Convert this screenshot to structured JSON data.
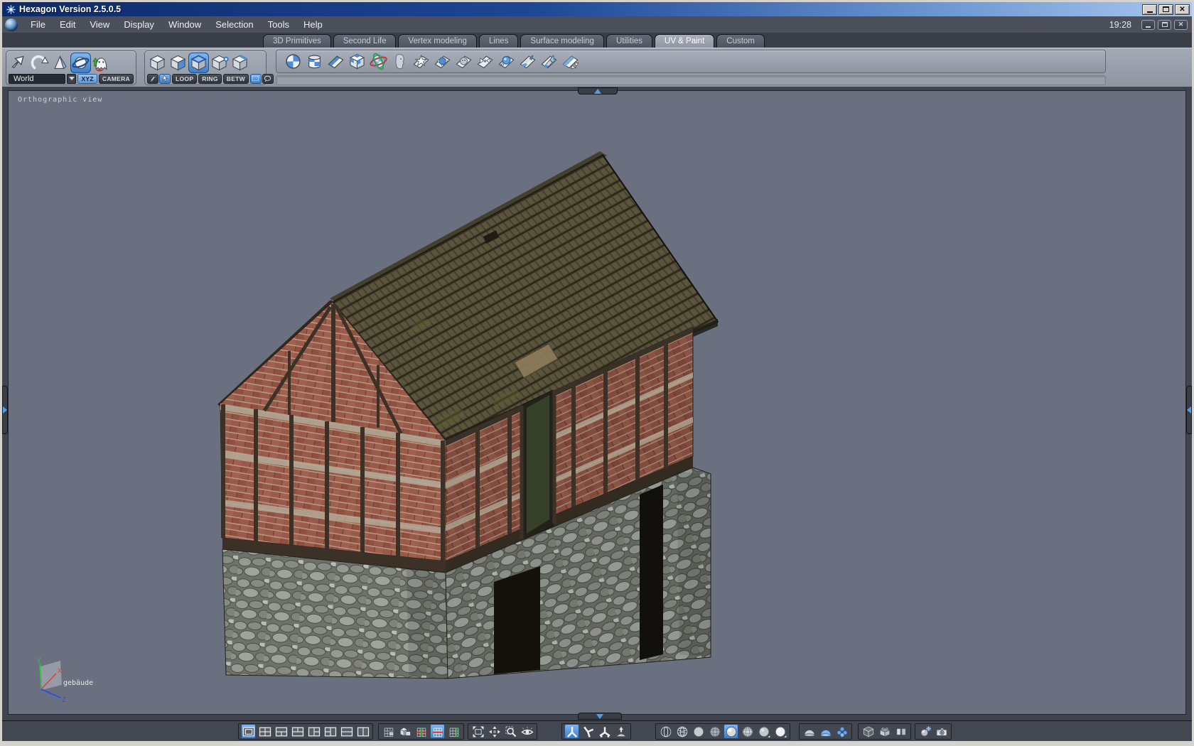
{
  "window": {
    "title": "Hexagon Version 2.5.0.5",
    "controls": [
      "minimize-icon",
      "maximize-icon",
      "close-icon"
    ]
  },
  "menubar": {
    "items": [
      "File",
      "Edit",
      "View",
      "Display",
      "Window",
      "Selection",
      "Tools",
      "Help"
    ],
    "clock": "19:28",
    "window_controls": [
      "minimize-icon",
      "maximize-icon",
      "close-icon"
    ]
  },
  "tabbar": {
    "tabs": [
      {
        "label": "3D Primitives",
        "active": false
      },
      {
        "label": "Second Life",
        "active": false
      },
      {
        "label": "Vertex modeling",
        "active": false
      },
      {
        "label": "Lines",
        "active": false
      },
      {
        "label": "Surface modeling",
        "active": false
      },
      {
        "label": "Utilities",
        "active": false
      },
      {
        "label": "UV & Paint",
        "active": true
      },
      {
        "label": "Custom",
        "active": false
      }
    ]
  },
  "toolbar": {
    "manipulator_group": {
      "icons": [
        {
          "name": "select-arrow-tool",
          "glyph": "arrow-nw",
          "active": false
        },
        {
          "name": "rotate-arrow-tool",
          "glyph": "arrow-curved",
          "active": false
        },
        {
          "name": "cone-manipulator-tool",
          "glyph": "cone",
          "active": false
        },
        {
          "name": "sphere-manipulator-tool",
          "glyph": "sphere-ring",
          "active": true
        },
        {
          "name": "ghost-visibility-tool",
          "glyph": "ghost",
          "active": false
        }
      ],
      "world_selector": {
        "value": "World"
      },
      "xyz_toggle": {
        "label": "XYZ",
        "active": true
      },
      "camera_toggle": {
        "label": "CAMERA",
        "active": false
      }
    },
    "selection_mode_group": {
      "icons": [
        {
          "name": "object-selection-mode",
          "glyph": "cube",
          "active": false
        },
        {
          "name": "face-selection-mode",
          "glyph": "cube-face",
          "active": false
        },
        {
          "name": "edge-selection-mode",
          "glyph": "cube-top",
          "active": true
        },
        {
          "name": "vertex-selection-mode",
          "glyph": "cube-vertex",
          "active": false
        },
        {
          "name": "border-selection-mode",
          "glyph": "cube-edge",
          "active": false
        }
      ],
      "small_tools": [
        {
          "name": "paint-select-tool",
          "glyph": "brush-sm",
          "active": false
        },
        {
          "name": "arrow-select-tool",
          "glyph": "arrow-sm",
          "active": true
        }
      ],
      "buttons": [
        {
          "label": "LOOP"
        },
        {
          "label": "RING"
        },
        {
          "label": "BETW"
        }
      ],
      "marquee_tools": [
        {
          "name": "rectangle-select-tool",
          "glyph": "marquee",
          "active": true
        },
        {
          "name": "lasso-select-tool",
          "glyph": "lasso",
          "active": false
        }
      ]
    },
    "uv_paint_tools": [
      {
        "name": "spherical-projection-tool",
        "glyph": "sphere-check"
      },
      {
        "name": "cylindrical-projection-tool",
        "glyph": "cyl-check"
      },
      {
        "name": "planar-projection-tool",
        "glyph": "plane-check"
      },
      {
        "name": "cubic-projection-tool",
        "glyph": "cube-check"
      },
      {
        "name": "uv-globe-unwrap-tool",
        "glyph": "globe"
      },
      {
        "name": "unfold-head-tool",
        "glyph": "head"
      },
      {
        "name": "star-stamp-tool",
        "glyph": "star-plane"
      },
      {
        "name": "inflate-surface-tool",
        "glyph": "pts-plane"
      },
      {
        "name": "smudge-surface-tool",
        "glyph": "face-plane"
      },
      {
        "name": "pinch-surface-tool",
        "glyph": "pinch-plane"
      },
      {
        "name": "bump-surface-tool",
        "glyph": "sphere-plane"
      },
      {
        "name": "paint-brush-tool",
        "glyph": "brush-plane"
      },
      {
        "name": "paint-tube-tool",
        "glyph": "brush2-plane"
      },
      {
        "name": "uv-transform-tool",
        "glyph": "plane-arrows"
      }
    ]
  },
  "viewport": {
    "label": "Orthographic view",
    "object_name": "gebäude",
    "axes": {
      "x": "X",
      "y": "Y",
      "z": "Z"
    },
    "background": "#6a7080",
    "collapse_handles": [
      "top",
      "bottom",
      "left",
      "right"
    ],
    "model_materials": {
      "roof_tiles": "#57503a",
      "brick": "#9a5a49",
      "timber": "#3c3127",
      "stone": "#8b9089",
      "mortar_band": "#b0a593"
    }
  },
  "bottombar": {
    "groups": [
      {
        "name": "viewport-layouts",
        "icons": [
          {
            "name": "layout-single-button",
            "glyph": "layout-1",
            "active": true
          },
          {
            "name": "layout-quad-button",
            "glyph": "layout-4"
          },
          {
            "name": "layout-top1-bottom2-button",
            "glyph": "layout-1t2b"
          },
          {
            "name": "layout-top2-bottom1-button",
            "glyph": "layout-2t1b"
          },
          {
            "name": "layout-left1-right2-button",
            "glyph": "layout-1l2r"
          },
          {
            "name": "layout-left2-right1-button",
            "glyph": "layout-2l1r"
          },
          {
            "name": "layout-2-rows-button",
            "glyph": "layout-2h"
          },
          {
            "name": "layout-2-columns-button",
            "glyph": "layout-2v"
          }
        ]
      },
      {
        "name": "grid-options",
        "icons": [
          {
            "name": "grid-paint-toggle",
            "glyph": "grid-lock"
          },
          {
            "name": "grid-lock-toggle",
            "glyph": "cube-lock"
          },
          {
            "name": "grid-xz-plane-toggle",
            "glyph": "grid-rg"
          },
          {
            "name": "grid-xy-plane-toggle",
            "glyph": "grid-blue",
            "active": true
          },
          {
            "name": "grid-yz-plane-toggle",
            "glyph": "grid-g"
          }
        ]
      },
      {
        "name": "view-controls",
        "icons": [
          {
            "name": "fit-view-button",
            "glyph": "expand"
          },
          {
            "name": "pan-view-button",
            "glyph": "pan"
          },
          {
            "name": "zoom-view-button",
            "glyph": "zoom"
          },
          {
            "name": "look-at-button",
            "glyph": "eye"
          }
        ]
      },
      {
        "name": "orientation-controls",
        "icons": [
          {
            "name": "axis-tripod-button",
            "glyph": "axis-y",
            "active": true
          },
          {
            "name": "axis-rotated-button",
            "glyph": "axis-k"
          },
          {
            "name": "axis-free-button",
            "glyph": "axis-bent"
          },
          {
            "name": "drop-to-view-button",
            "glyph": "dome-drop"
          }
        ]
      },
      {
        "name": "shading-modes",
        "icons": [
          {
            "name": "wireframe-mode-button",
            "glyph": "ball-wire"
          },
          {
            "name": "hidden-line-mode-button",
            "glyph": "ball-wire2"
          },
          {
            "name": "flat-shading-button",
            "glyph": "ball-flat"
          },
          {
            "name": "shaded-wireframe-button",
            "glyph": "ball-wiregrid"
          },
          {
            "name": "smooth-shading-button",
            "glyph": "ball-shaded",
            "active": true
          },
          {
            "name": "textured-shading-button",
            "glyph": "ball-grid"
          },
          {
            "name": "matte-shading-button",
            "glyph": "ball-matte",
            "flyout": true
          },
          {
            "name": "bright-shading-button",
            "glyph": "ball-bright",
            "flyout": true
          }
        ]
      },
      {
        "name": "backface-modes",
        "icons": [
          {
            "name": "dome-backface-button",
            "glyph": "dome"
          },
          {
            "name": "dome-shaded-button",
            "glyph": "dome-blue"
          },
          {
            "name": "multi-object-button",
            "glyph": "cluster"
          }
        ]
      },
      {
        "name": "display-extras",
        "icons": [
          {
            "name": "ghost-cube-toggle",
            "glyph": "cube-ghost"
          },
          {
            "name": "open-box-toggle",
            "glyph": "open-box"
          },
          {
            "name": "side-panels-toggle",
            "glyph": "panels"
          }
        ]
      },
      {
        "name": "render-controls",
        "icons": [
          {
            "name": "render-button",
            "glyph": "render"
          },
          {
            "name": "snapshot-camera-button",
            "glyph": "camera"
          }
        ]
      }
    ]
  },
  "colors": {
    "accent_blue": "#5b9bd5",
    "titlebar_left": "#0d2a6a",
    "titlebar_right": "#a8c6ec",
    "toolbar_gray": "#9aa0ab",
    "bottombar_gray": "#43474f",
    "viewport_bg": "#6a7080"
  }
}
